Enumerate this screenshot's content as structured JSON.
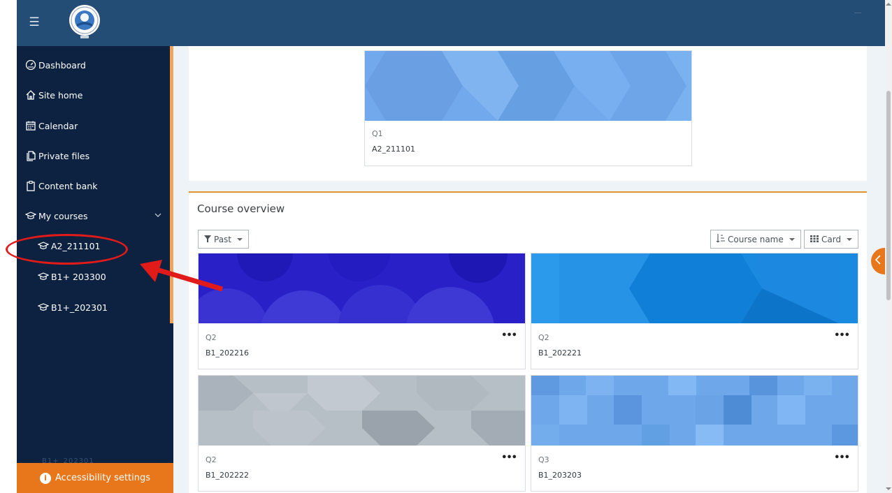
{
  "topbar": {
    "menu_icon": "hamburger-menu-icon",
    "logo": "university-logo"
  },
  "sidebar": {
    "items": [
      {
        "label": "Dashboard",
        "icon": "dashboard-gauge-icon"
      },
      {
        "label": "Site home",
        "icon": "home-icon"
      },
      {
        "label": "Calendar",
        "icon": "calendar-icon"
      },
      {
        "label": "Private files",
        "icon": "files-icon"
      },
      {
        "label": "Content bank",
        "icon": "clipboard-icon"
      },
      {
        "label": "My courses",
        "icon": "graduation-cap-icon"
      }
    ],
    "courses": [
      {
        "label": "A2_211101",
        "icon": "graduation-cap-icon"
      },
      {
        "label": "B1+ 203300",
        "icon": "graduation-cap-icon"
      },
      {
        "label": "B1+_202301",
        "icon": "graduation-cap-icon"
      }
    ],
    "faded_item": "B1+_202301"
  },
  "accessibility": {
    "label": "Accessibility settings",
    "icon": "accessibility-icon"
  },
  "recent": {
    "cat": "Q1",
    "name": "A2_211101"
  },
  "overview": {
    "title": "Course overview",
    "filter_label": "Past",
    "sort_label": "Course name",
    "view_label": "Card",
    "cards": [
      {
        "cat": "Q2",
        "name": "B1_202216",
        "more": "•••"
      },
      {
        "cat": "Q2",
        "name": "B1_202221",
        "more": "•••"
      },
      {
        "cat": "Q2",
        "name": "B1_202222",
        "more": "•••"
      },
      {
        "cat": "Q3",
        "name": "B1_203203",
        "more": "•••"
      }
    ]
  },
  "colors": {
    "navbar": "#244d75",
    "sidebar": "#0d2240",
    "accent_orange": "#e8761a",
    "annotation_red": "#e11a1a"
  }
}
